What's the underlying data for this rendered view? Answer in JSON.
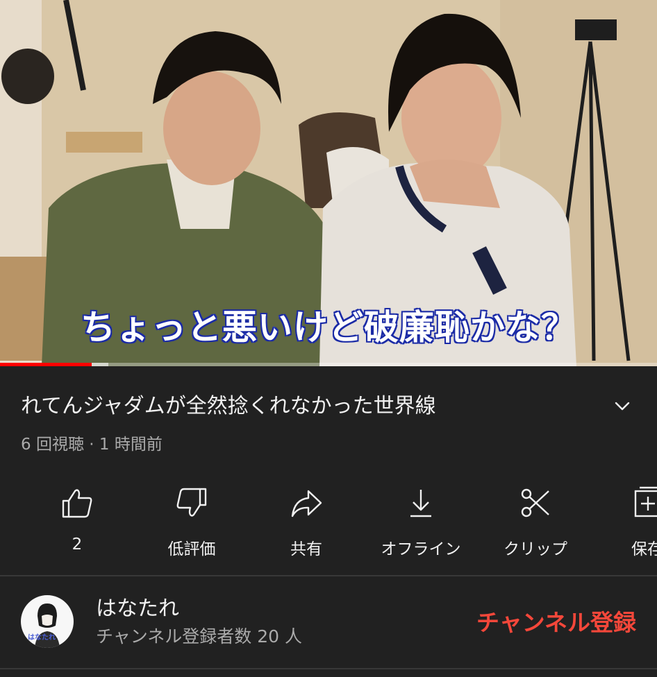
{
  "video": {
    "caption": "ちょっと悪いけど破廉恥かな？",
    "progress_percent": 14
  },
  "details": {
    "title": "れてんジャダムが全然捻くれなかった世界線",
    "meta": "6 回視聴 · 1 時間前"
  },
  "actions": [
    {
      "icon": "thumbs-up-icon",
      "label": "2"
    },
    {
      "icon": "thumbs-down-icon",
      "label": "低評価"
    },
    {
      "icon": "share-icon",
      "label": "共有"
    },
    {
      "icon": "download-icon",
      "label": "オフライン"
    },
    {
      "icon": "scissors-icon",
      "label": "クリップ"
    },
    {
      "icon": "save-playlist-icon",
      "label": "保存"
    }
  ],
  "channel": {
    "name": "はなたれ",
    "subscribers": "チャンネル登録者数 20 人",
    "avatar_text": "はなたれ",
    "subscribe_label": "チャンネル登録"
  },
  "colors": {
    "background": "#212121",
    "subscribe": "#f4473a",
    "progress": "#ff0000"
  }
}
